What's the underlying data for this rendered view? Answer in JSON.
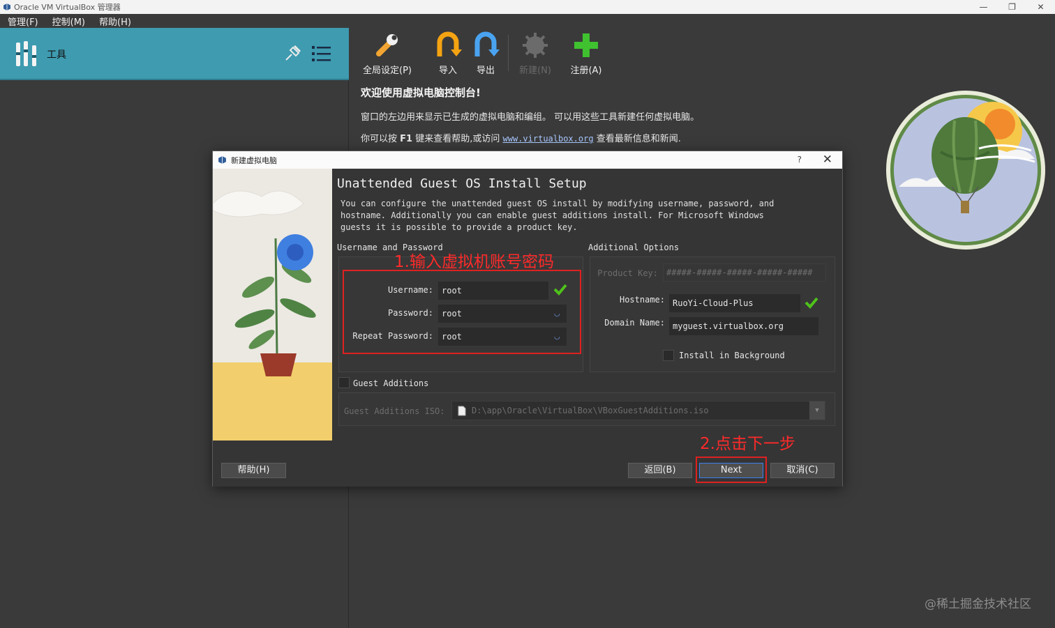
{
  "window": {
    "title": "Oracle VM VirtualBox 管理器"
  },
  "menu": {
    "items": [
      "管理(F)",
      "控制(M)",
      "帮助(H)"
    ]
  },
  "tools": {
    "label": "工具"
  },
  "toolbar": {
    "global": "全局设定(P)",
    "import": "导入",
    "export": "导出",
    "new": "新建(N)",
    "register": "注册(A)"
  },
  "welcome": {
    "title": "欢迎使用虚拟电脑控制台!",
    "line1": "窗口的左边用来显示已生成的虚拟电脑和编组。 可以用这些工具新建任何虚拟电脑。",
    "line2_prefix": "你可以按",
    "line2_key": "F1",
    "line2_mid": "键来查看帮助,或访问",
    "line2_link": "www.virtualbox.org",
    "line2_suffix": "查看最新信息和新闻."
  },
  "dialog": {
    "title": "新建虚拟电脑",
    "help": "?",
    "heading": "Unattended Guest OS Install Setup",
    "description": "You can configure the unattended guest OS install by modifying username, password, and hostname. Additionally you can enable guest additions install. For Microsoft Windows guests it is possible to provide a product key.",
    "userpass": {
      "group_label": "Username and Password",
      "username_label": "Username:",
      "username_value": "root",
      "password_label": "Password:",
      "password_value": "root",
      "repeat_label": "Repeat Password:",
      "repeat_value": "root"
    },
    "options": {
      "group_label": "Additional Options",
      "product_key_label": "Product Key:",
      "product_key_placeholder": "#####-#####-#####-#####-#####",
      "hostname_label": "Hostname:",
      "hostname_value": "RuoYi-Cloud-Plus",
      "domain_label": "Domain Name:",
      "domain_value": "myguest.virtualbox.org",
      "install_bg_label": "Install in Background"
    },
    "guest_additions": {
      "label": "Guest Additions",
      "iso_label": "Guest Additions ISO:",
      "iso_value": "D:\\app\\Oracle\\VirtualBox\\VBoxGuestAdditions.iso"
    },
    "buttons": {
      "help": "帮助(H)",
      "back": "返回(B)",
      "next": "Next",
      "cancel": "取消(C)"
    }
  },
  "annotations": {
    "step1": "1.输入虚拟机账号密码",
    "step2": "2.点击下一步"
  },
  "watermark": "@稀土掘金技术社区",
  "colors": {
    "accent": "#3e9bb0",
    "annotation": "#e02020",
    "check": "#4ec21a"
  }
}
